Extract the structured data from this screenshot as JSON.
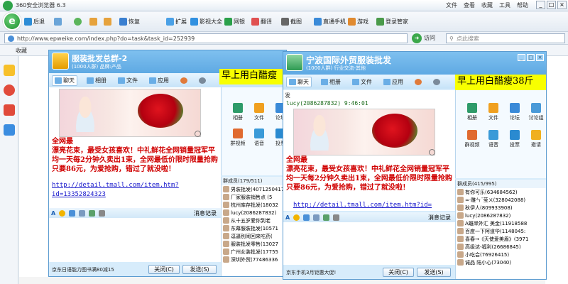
{
  "browser": {
    "title": "360安全浏览器 6.3",
    "menus": [
      "文件",
      "查看",
      "收藏",
      "工具",
      "帮助"
    ],
    "toolbar": [
      {
        "label": "后退",
        "icon": "back-arrow-icon"
      },
      {
        "label": "",
        "icon": "forward-arrow-icon"
      },
      {
        "label": "",
        "icon": "refresh-icon"
      },
      {
        "label": "",
        "icon": "home-icon"
      },
      {
        "label": "恢复",
        "icon": "restore-icon"
      },
      {
        "label": "扩展",
        "icon": "grid-icon"
      },
      {
        "label": "影视大全",
        "icon": "video-icon"
      },
      {
        "label": "网银",
        "icon": "bank-icon"
      },
      {
        "label": "翻译",
        "icon": "translate-icon"
      },
      {
        "label": "截图",
        "icon": "scissors-icon"
      },
      {
        "label": "直通手机",
        "icon": "phone-icon"
      },
      {
        "label": "游戏",
        "icon": "game-icon"
      },
      {
        "label": "登录管家",
        "icon": "user-icon"
      }
    ],
    "url": "http://www.epweike.com/index.php?do=task&task_id=252939",
    "visit_label": "访问",
    "search_placeholder": "点此搜索",
    "fav_label": "收藏"
  },
  "window_left": {
    "group_name": "服装批发总群-2",
    "group_sub": "(1000人群) 品牌:产品",
    "tabs": [
      "聊天",
      "相册",
      "文件",
      "应用"
    ],
    "ad_text": "早上用白醋瘦",
    "message_red": "全网最\n漂亮花束，最受女孩喜欢！中礼鲜花全网销量冠军平均一天每2分钟久卖出1束，全网最低价限时限量抢购只要86元，为爱抢购，错过了就没啦！",
    "link": "http://detail.tmall.com/item.htm?id=13352824323",
    "apps": [
      "相册",
      "文件",
      "论坛",
      "群视频",
      "语音",
      "投票"
    ],
    "members_header": "群成员(179/511)",
    "members": [
      "男装批发(4071250417)",
      "厂家服装销售点 (5",
      "杭州库存批发(18032",
      "lucy(2086287832)",
      "从十五岁爱你到老",
      "东幕服装批发(10571",
      "逗逼别闹回来吃药(",
      "服装批发零售(13027",
      "广州女装批发(17755",
      "深圳外贸(77486336"
    ],
    "input_label": "消息记录",
    "ad_footer": "京东日语能力图书满80减15",
    "close_btn": "关闭(C)",
    "send_btn": "发送(S)"
  },
  "window_right": {
    "group_name": "宁波国际外贸服装批发",
    "group_sub": "(1000人群) 行业交流-其他",
    "tabs": [
      "聊天",
      "相册",
      "文件",
      "应用"
    ],
    "ad_text": "早上用白醋瘦38斤",
    "sender": "lucy(2086287832)  9:46:01",
    "msg_prefix": "发",
    "message_red": "全网最\n漂亮花束，最受女孩喜欢！中礼鲜花全网销量冠军平均一天每2分钟久卖出1束，全网最低价限时限量抢购只要86元，为爱抢购，错过了就没啦！",
    "link": "http://detail.tmall.com/item.htm?id=",
    "apps": [
      "相册",
      "文件",
      "论坛",
      "讨论组",
      "群视频",
      "语音",
      "投票",
      "邀请"
    ],
    "members_header": "群成员(415/995)",
    "members": [
      "有你可乐(634684562)",
      "≈·雕ㄣ¨莹ㄨ(328042088)",
      "秋伊人(809933908)",
      "lucy(2086287832)",
      "A離岸外汇 美金(11918588",
      "百度一下阿道华(1148045:",
      "喜春→《天使爱美眉》(3971",
      "高级达-福利(26686845)",
      "小吃会(76926415)",
      "诚品 陆小心(73040)"
    ],
    "input_label": "消息记录",
    "ad_footer": "京东手机3月钜惠大促!",
    "close_btn": "关闭(C)",
    "send_btn": "发送(S)"
  },
  "colors": {
    "head": "#5ea9e3",
    "ad": "#f8ff00",
    "red": "#d00000",
    "link": "#1a1acc"
  }
}
